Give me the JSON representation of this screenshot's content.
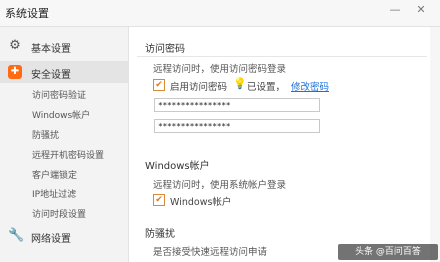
{
  "window": {
    "title": "系统设置",
    "minimize_glyph": "—",
    "close_glyph": "✕"
  },
  "sidebar": {
    "items": [
      {
        "label": "基本设置",
        "icon": "gear-icon",
        "glyph": "⚙"
      },
      {
        "label": "安全设置",
        "icon": "shield-icon",
        "glyph": "✚"
      },
      {
        "label": "网络设置",
        "icon": "wrench-icon",
        "glyph": "🔧"
      }
    ],
    "sub_items": [
      "访问密码验证",
      "Windows帐户",
      "防骚扰",
      "远程开机密码设置",
      "客户端锁定",
      "IP地址过滤",
      "访问时段设置"
    ]
  },
  "access_password": {
    "title": "访问密码",
    "description": "远程访问时，使用访问密码登录",
    "enable_label": "启用访问密码",
    "enable_checked": true,
    "check_glyph": "✔",
    "bulb_glyph": "💡",
    "status": "已设置，",
    "modify_link": "修改密码",
    "password_value": "****************",
    "confirm_value": "****************"
  },
  "windows_account": {
    "title": "Windows帐户",
    "description": "远程访问时，使用系统帐户登录",
    "checkbox_label": "Windows帐户",
    "checked": true
  },
  "anti_harass": {
    "title": "防骚扰",
    "description": "是否接受快速远程访问申请"
  },
  "watermark": {
    "text": "头条 @百问百答"
  },
  "colors": {
    "accent": "#ff6a13",
    "link": "#1a6fd8",
    "check": "#e07a20"
  }
}
